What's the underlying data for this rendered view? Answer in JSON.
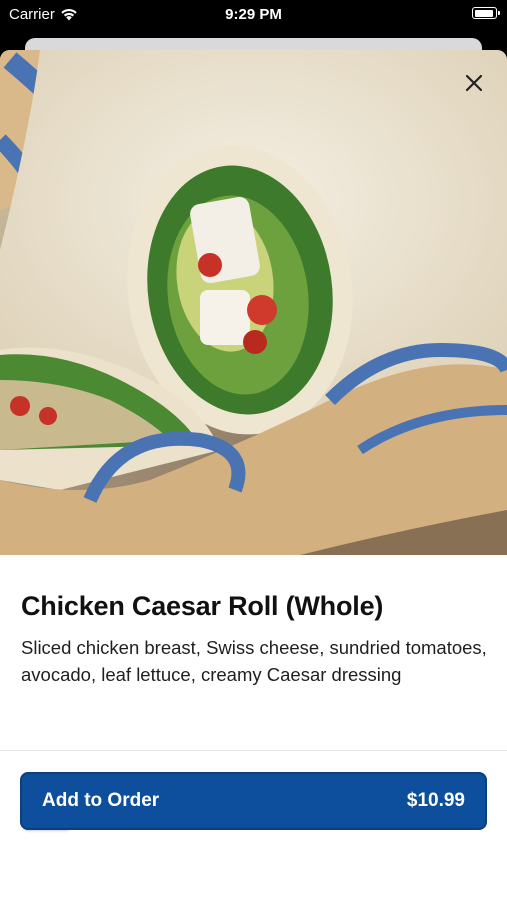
{
  "status_bar": {
    "carrier": "Carrier",
    "time": "9:29 PM"
  },
  "item": {
    "title": "Chicken Caesar Roll (Whole)",
    "description": "Sliced chicken breast, Swiss cheese, sundried tomatoes, avocado, leaf lettuce, creamy Caesar dressing",
    "image_icon": "food-photo"
  },
  "actions": {
    "favorite_icon": "heart-icon",
    "close_icon": "close-icon",
    "add_label": "Add to Order",
    "price": "$10.99"
  },
  "colors": {
    "primary": "#0d4f9c",
    "text": "#111111"
  }
}
